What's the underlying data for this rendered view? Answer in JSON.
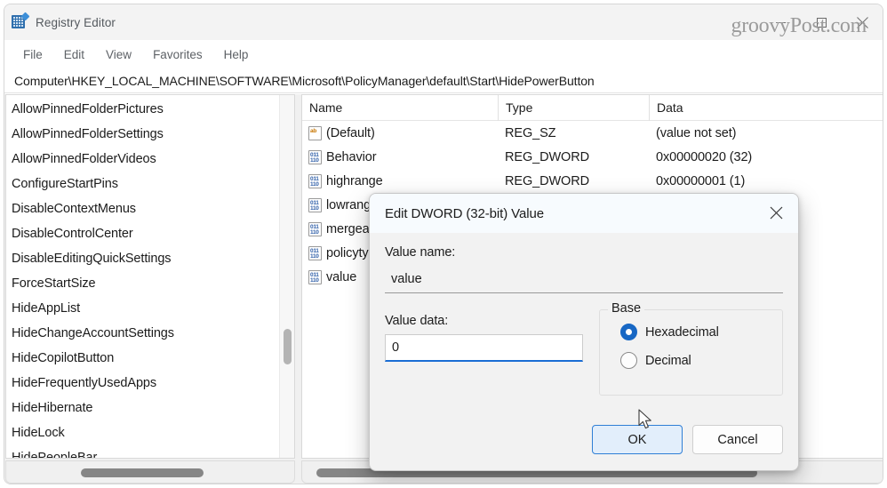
{
  "window": {
    "title": "Registry Editor",
    "app_icon": "registry-icon",
    "watermark": "groovyPost.com",
    "controls": {
      "minimize": "minimize",
      "maximize": "maximize",
      "close": "close"
    }
  },
  "menubar": {
    "items": [
      "File",
      "Edit",
      "View",
      "Favorites",
      "Help"
    ]
  },
  "address": {
    "path": "Computer\\HKEY_LOCAL_MACHINE\\SOFTWARE\\Microsoft\\PolicyManager\\default\\Start\\HidePowerButton"
  },
  "tree": {
    "items": [
      "AllowPinnedFolderPictures",
      "AllowPinnedFolderSettings",
      "AllowPinnedFolderVideos",
      "ConfigureStartPins",
      "DisableContextMenus",
      "DisableControlCenter",
      "DisableEditingQuickSettings",
      "ForceStartSize",
      "HideAppList",
      "HideChangeAccountSettings",
      "HideCopilotButton",
      "HideFrequentlyUsedApps",
      "HideHibernate",
      "HideLock",
      "HidePeopleBar"
    ]
  },
  "values": {
    "headers": [
      "Name",
      "Type",
      "Data"
    ],
    "rows": [
      {
        "icon": "string-value-icon",
        "icon_kind": "sz",
        "name": "(Default)",
        "type": "REG_SZ",
        "data": "(value not set)"
      },
      {
        "icon": "dword-value-icon",
        "icon_kind": "dword",
        "name": "Behavior",
        "type": "REG_DWORD",
        "data": "0x00000020 (32)"
      },
      {
        "icon": "dword-value-icon",
        "icon_kind": "dword",
        "name": "highrange",
        "type": "REG_DWORD",
        "data": "0x00000001 (1)"
      },
      {
        "icon": "dword-value-icon",
        "icon_kind": "dword",
        "name": "lowrange",
        "type": "",
        "data": ""
      },
      {
        "icon": "dword-value-icon",
        "icon_kind": "dword",
        "name": "mergealgorithm",
        "type": "",
        "data": ""
      },
      {
        "icon": "dword-value-icon",
        "icon_kind": "dword",
        "name": "policytype",
        "type": "",
        "data": ""
      },
      {
        "icon": "dword-value-icon",
        "icon_kind": "dword",
        "name": "value",
        "type": "",
        "data": ""
      }
    ]
  },
  "dialog": {
    "title": "Edit DWORD (32-bit) Value",
    "close_icon": "close-icon",
    "value_name_label": "Value name:",
    "value_name": "value",
    "value_data_label": "Value data:",
    "value_data": "0",
    "base_legend": "Base",
    "base_options": [
      {
        "label": "Hexadecimal",
        "checked": true
      },
      {
        "label": "Decimal",
        "checked": false
      }
    ],
    "ok_label": "OK",
    "cancel_label": "Cancel"
  },
  "colors": {
    "accent": "#1767c4",
    "default_button_bg": "#e2eefb",
    "sz_icon": "#c77500",
    "dword_icon": "#2f5fa8"
  }
}
